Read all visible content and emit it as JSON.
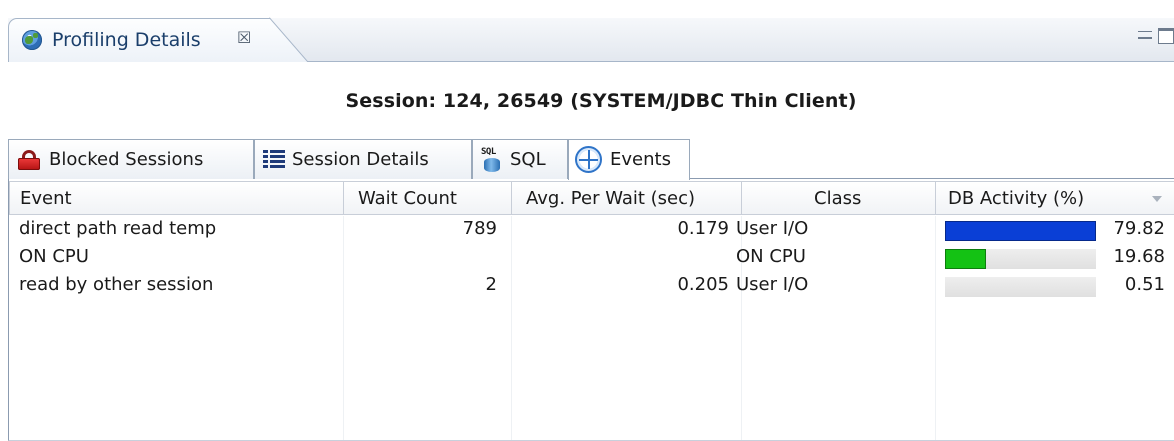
{
  "view": {
    "tab_title": "Profiling Details",
    "close_glyph": "☒",
    "session_title": "Session: 124, 26549 (SYSTEM/JDBC Thin Client)"
  },
  "tabs": [
    {
      "label": "Blocked Sessions",
      "icon": "lock-icon",
      "active": false
    },
    {
      "label": "Session Details",
      "icon": "details-icon",
      "active": false
    },
    {
      "label": "SQL",
      "icon": "sql-icon",
      "active": false
    },
    {
      "label": "Events",
      "icon": "events-icon",
      "active": true
    }
  ],
  "sql_icon_text": "SQL",
  "table": {
    "columns": [
      "Event",
      "Wait Count",
      "Avg. Per Wait (sec)",
      "Class",
      "DB Activity (%)"
    ],
    "rows": [
      {
        "event": "direct path read temp",
        "wait_count": "789",
        "avg_per_wait": "0.179",
        "class": "User I/O",
        "db_activity": "79.82",
        "bar_fraction": 0.9982,
        "bar_color": "#0a3fd6"
      },
      {
        "event": "ON CPU",
        "wait_count": "",
        "avg_per_wait": "",
        "class": "ON CPU",
        "db_activity": "19.68",
        "bar_fraction": 0.2706,
        "bar_color": "#14c214"
      },
      {
        "event": "read by other session",
        "wait_count": "2",
        "avg_per_wait": "0.205",
        "class": "User I/O",
        "db_activity": "0.51",
        "bar_fraction": 0.0,
        "bar_color": "#0a3fd6"
      }
    ]
  }
}
